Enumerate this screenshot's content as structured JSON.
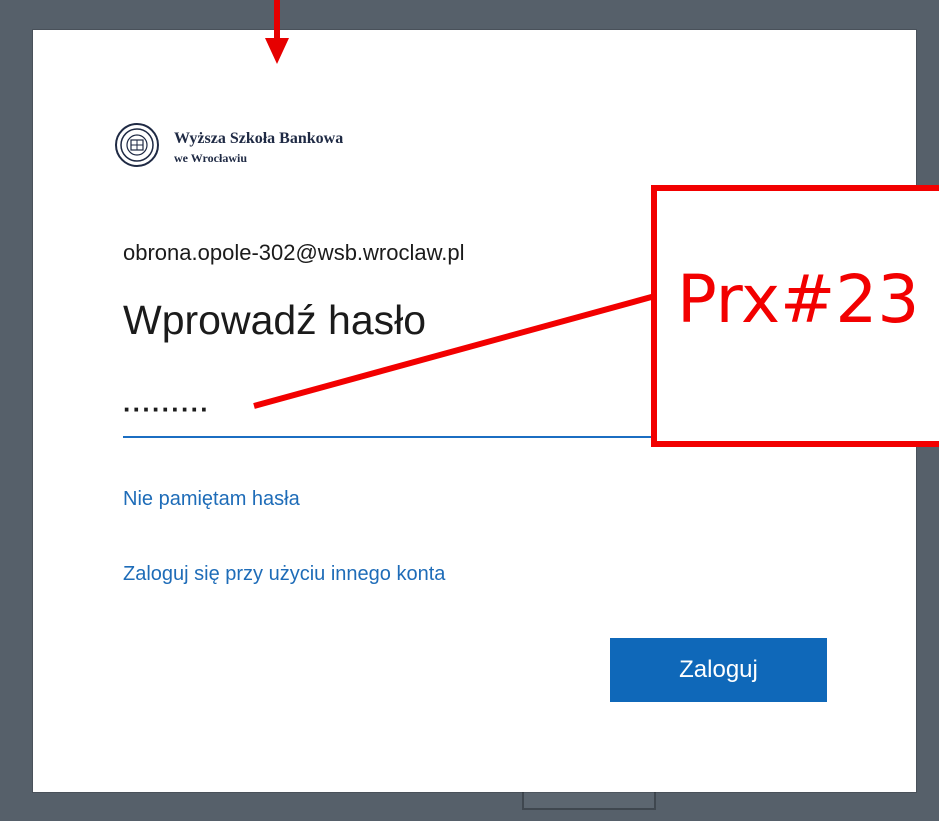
{
  "brand": {
    "name_line1": "Wyższa Szkoła Bankowa",
    "name_line2": "we Wrocławiu",
    "logo_icon": "wsb-crest-icon"
  },
  "login": {
    "account_email": "obrona.opole-302@wsb.wroclaw.pl",
    "heading": "Wprowadź hasło",
    "password_masked": "·········",
    "forgot_password_link": "Nie pamiętam hasła",
    "other_account_link": "Zaloguj się przy użyciu innego konta",
    "submit_button": "Zaloguj"
  },
  "annotation": {
    "callout_text": "Prx#23",
    "color": "#f20000"
  },
  "colors": {
    "accent": "#0f68b9",
    "link": "#1e6cb8",
    "backdrop": "#56606a"
  }
}
